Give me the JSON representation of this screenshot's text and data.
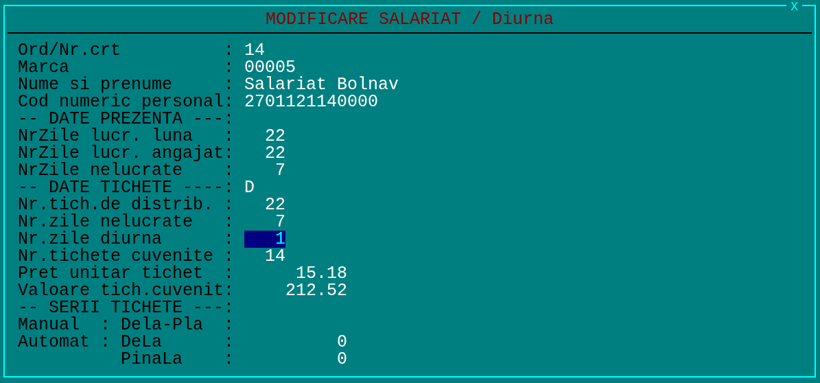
{
  "window": {
    "title": "MODIFICARE SALARIAT / Diurna",
    "close": "X"
  },
  "rows": [
    {
      "kind": "text",
      "label": "Ord/Nr.crt",
      "separator": ":",
      "value": "14",
      "focused": false
    },
    {
      "kind": "text",
      "label": "Marca",
      "separator": ":",
      "value": "00005",
      "focused": false
    },
    {
      "kind": "text",
      "label": "Nume si prenume",
      "separator": ":",
      "value": "Salariat Bolnav",
      "focused": false
    },
    {
      "kind": "text",
      "label": "Cod numeric personal",
      "separator": ":",
      "value": "2701121140000",
      "focused": false
    },
    {
      "kind": "section",
      "label": "-- DATE PREZENTA ---",
      "separator": ":"
    },
    {
      "kind": "count",
      "label": "NrZile lucr. luna",
      "separator": ":",
      "value": "22",
      "focused": false
    },
    {
      "kind": "count",
      "label": "NrZile lucr. angajat",
      "separator": ":",
      "value": "22",
      "focused": false
    },
    {
      "kind": "count",
      "label": "NrZile nelucrate",
      "separator": ":",
      "value": "7",
      "focused": false
    },
    {
      "kind": "section",
      "label": "-- DATE TICHETE ----",
      "separator": ":",
      "value": "D"
    },
    {
      "kind": "count",
      "label": "Nr.tich.de distrib.",
      "separator": ":",
      "value": "22",
      "focused": false
    },
    {
      "kind": "count",
      "label": "Nr.zile nelucrate",
      "separator": ":",
      "value": "7",
      "focused": false
    },
    {
      "kind": "count",
      "label": "Nr.zile diurna",
      "separator": ":",
      "value": "1",
      "focused": true
    },
    {
      "kind": "count",
      "label": "Nr.tichete cuvenite",
      "separator": ":",
      "value": "14",
      "focused": false
    },
    {
      "kind": "amount",
      "label": "Pret unitar tichet",
      "separator": ":",
      "value": "15.18",
      "focused": false
    },
    {
      "kind": "amount",
      "label": "Valoare tich.cuvenit",
      "separator": ":",
      "value": "212.52",
      "focused": false
    },
    {
      "kind": "section",
      "label": "-- SERII TICHETE ---",
      "separator": ":"
    },
    {
      "kind": "series",
      "label": "Manual",
      "label_separator": ":",
      "sublabel": "Dela-Pla",
      "separator": ":"
    },
    {
      "kind": "series",
      "label": "Automat",
      "label_separator": ":",
      "sublabel": "DeLa",
      "separator": ":",
      "value": "0"
    },
    {
      "kind": "series",
      "sublabel": "PinaLa",
      "separator": ":",
      "value": "0"
    }
  ]
}
